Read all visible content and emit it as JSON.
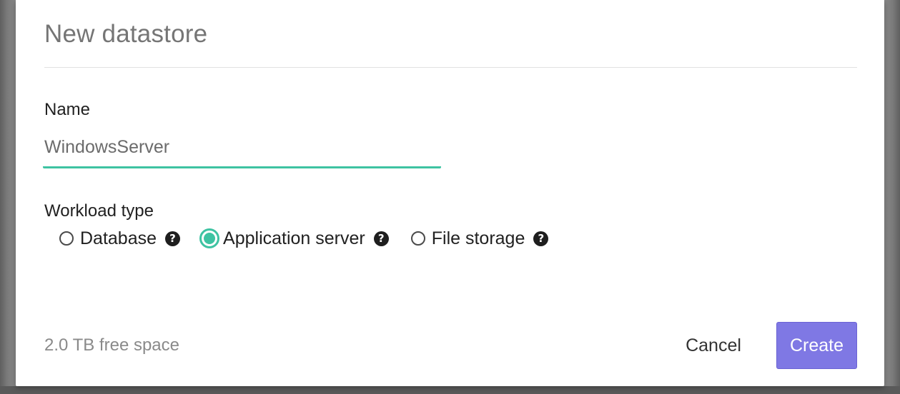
{
  "dialog": {
    "title": "New datastore",
    "name_label": "Name",
    "name_value": "WindowsServer",
    "workload_label": "Workload type",
    "workload_options": [
      {
        "label": "Database",
        "selected": false,
        "help_icon": "question-circle-icon"
      },
      {
        "label": "Application server",
        "selected": true,
        "help_icon": "question-circle-icon"
      },
      {
        "label": "File storage",
        "selected": false,
        "help_icon": "question-circle-icon"
      }
    ],
    "free_space": "2.0 TB free space",
    "cancel_label": "Cancel",
    "create_label": "Create"
  },
  "colors": {
    "accent": "#3ec3a2",
    "primary_button": "#7f78e4",
    "title_text": "#757575",
    "muted_text": "#8a8a8a"
  }
}
